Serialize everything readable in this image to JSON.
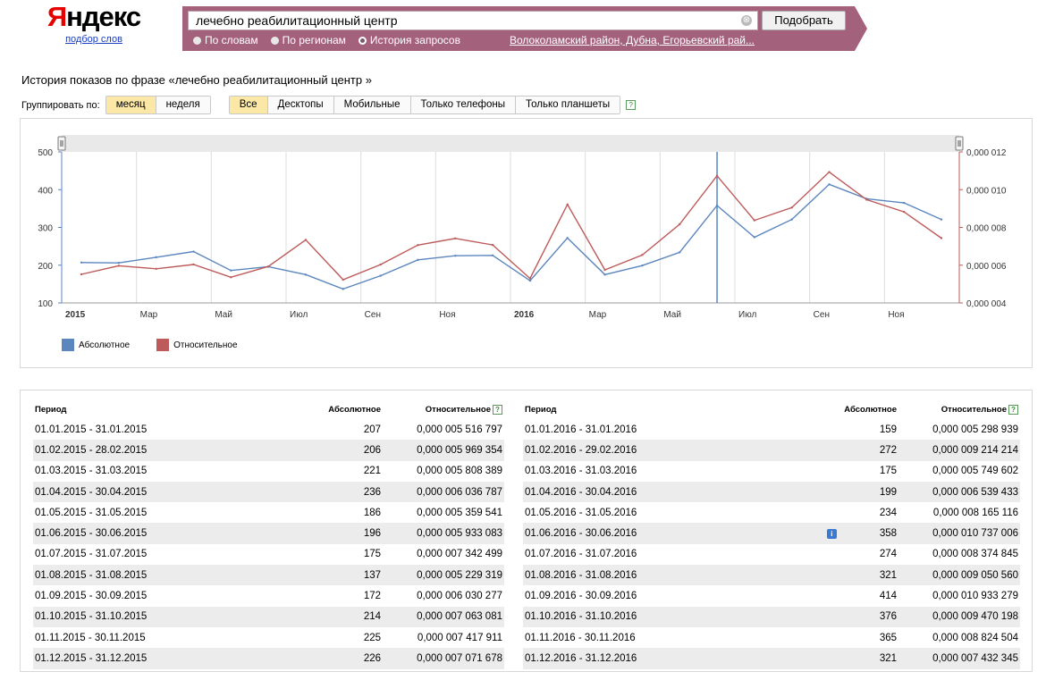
{
  "header": {
    "logo_text": "Яндекс",
    "logo_sub": "подбор слов",
    "search_value": "лечебно реабилитационный центр",
    "clear_glyph": "⊗",
    "search_button": "Подобрать",
    "radios": [
      {
        "label": "По словам",
        "selected": false
      },
      {
        "label": "По регионам",
        "selected": false
      },
      {
        "label": "История запросов",
        "selected": true
      }
    ],
    "region_link": "Волоколамский район, Дубна, Егорьевский рай..."
  },
  "page_title": "История показов по фразе «лечебно реабилитационный центр »",
  "grouping": {
    "label": "Группировать по:",
    "periods": [
      {
        "label": "месяц",
        "active": true
      },
      {
        "label": "неделя",
        "active": false
      }
    ],
    "devices": [
      {
        "label": "Все",
        "active": true
      },
      {
        "label": "Десктопы",
        "active": false
      },
      {
        "label": "Мобильные",
        "active": false
      },
      {
        "label": "Только телефоны",
        "active": false
      },
      {
        "label": "Только планшеты",
        "active": false
      }
    ],
    "help_glyph": "?"
  },
  "chart_data": {
    "type": "line",
    "x": [
      "2015-01",
      "2015-02",
      "2015-03",
      "2015-04",
      "2015-05",
      "2015-06",
      "2015-07",
      "2015-08",
      "2015-09",
      "2015-10",
      "2015-11",
      "2015-12",
      "2016-01",
      "2016-02",
      "2016-03",
      "2016-04",
      "2016-05",
      "2016-06",
      "2016-07",
      "2016-08",
      "2016-09",
      "2016-10",
      "2016-11",
      "2016-12"
    ],
    "x_tick_labels": [
      {
        "index": 0,
        "label": "2015",
        "bold": true
      },
      {
        "index": 2,
        "label": "Мар",
        "bold": false
      },
      {
        "index": 4,
        "label": "Май",
        "bold": false
      },
      {
        "index": 6,
        "label": "Июл",
        "bold": false
      },
      {
        "index": 8,
        "label": "Сен",
        "bold": false
      },
      {
        "index": 10,
        "label": "Ноя",
        "bold": false
      },
      {
        "index": 12,
        "label": "2016",
        "bold": true
      },
      {
        "index": 14,
        "label": "Мар",
        "bold": false
      },
      {
        "index": 16,
        "label": "Май",
        "bold": false
      },
      {
        "index": 18,
        "label": "Июл",
        "bold": false
      },
      {
        "index": 20,
        "label": "Сен",
        "bold": false
      },
      {
        "index": 22,
        "label": "Ноя",
        "bold": false
      }
    ],
    "y_left": {
      "min": 100,
      "max": 500,
      "ticks": [
        100,
        200,
        300,
        400,
        500
      ]
    },
    "y_right": {
      "min": 4e-06,
      "max": 1.2e-05,
      "ticks": [
        "0,000 004",
        "0,000 006",
        "0,000 008",
        "0,000 010",
        "0,000 012"
      ]
    },
    "series": [
      {
        "name": "Абсолютное",
        "color": "#5b86be",
        "axis": "left",
        "values": [
          207,
          206,
          221,
          236,
          186,
          196,
          175,
          137,
          172,
          214,
          225,
          226,
          159,
          272,
          175,
          199,
          234,
          358,
          274,
          321,
          414,
          376,
          365,
          321
        ]
      },
      {
        "name": "Относительное",
        "color": "#bd5a5a",
        "axis": "right",
        "values": [
          5.516797e-06,
          5.969354e-06,
          5.808389e-06,
          6.036787e-06,
          5.359541e-06,
          5.933083e-06,
          7.342499e-06,
          5.229319e-06,
          6.030277e-06,
          7.063081e-06,
          7.417911e-06,
          7.071678e-06,
          5.298939e-06,
          9.214214e-06,
          5.749602e-06,
          6.539433e-06,
          8.165116e-06,
          1.0737006e-05,
          8.374845e-06,
          9.05056e-06,
          1.0933279e-05,
          9.470198e-06,
          8.824504e-06,
          7.432345e-06
        ]
      }
    ],
    "marker_index": 17,
    "legend_position": "bottom-left",
    "grid": true
  },
  "table": {
    "headers": {
      "period": "Период",
      "absolute": "Абсолютное",
      "relative": "Относительное"
    },
    "info_glyph": "i",
    "left": [
      {
        "period": "01.01.2015 - 31.01.2015",
        "abs": "207",
        "rel": "0,000 005 516 797"
      },
      {
        "period": "01.02.2015 - 28.02.2015",
        "abs": "206",
        "rel": "0,000 005 969 354"
      },
      {
        "period": "01.03.2015 - 31.03.2015",
        "abs": "221",
        "rel": "0,000 005 808 389"
      },
      {
        "period": "01.04.2015 - 30.04.2015",
        "abs": "236",
        "rel": "0,000 006 036 787"
      },
      {
        "period": "01.05.2015 - 31.05.2015",
        "abs": "186",
        "rel": "0,000 005 359 541"
      },
      {
        "period": "01.06.2015 - 30.06.2015",
        "abs": "196",
        "rel": "0,000 005 933 083"
      },
      {
        "period": "01.07.2015 - 31.07.2015",
        "abs": "175",
        "rel": "0,000 007 342 499"
      },
      {
        "period": "01.08.2015 - 31.08.2015",
        "abs": "137",
        "rel": "0,000 005 229 319"
      },
      {
        "period": "01.09.2015 - 30.09.2015",
        "abs": "172",
        "rel": "0,000 006 030 277"
      },
      {
        "period": "01.10.2015 - 31.10.2015",
        "abs": "214",
        "rel": "0,000 007 063 081"
      },
      {
        "period": "01.11.2015 - 30.11.2015",
        "abs": "225",
        "rel": "0,000 007 417 911"
      },
      {
        "period": "01.12.2015 - 31.12.2015",
        "abs": "226",
        "rel": "0,000 007 071 678"
      }
    ],
    "right": [
      {
        "period": "01.01.2016 - 31.01.2016",
        "abs": "159",
        "rel": "0,000 005 298 939"
      },
      {
        "period": "01.02.2016 - 29.02.2016",
        "abs": "272",
        "rel": "0,000 009 214 214"
      },
      {
        "period": "01.03.2016 - 31.03.2016",
        "abs": "175",
        "rel": "0,000 005 749 602"
      },
      {
        "period": "01.04.2016 - 30.04.2016",
        "abs": "199",
        "rel": "0,000 006 539 433"
      },
      {
        "period": "01.05.2016 - 31.05.2016",
        "abs": "234",
        "rel": "0,000 008 165 116"
      },
      {
        "period": "01.06.2016 - 30.06.2016",
        "abs": "358",
        "rel": "0,000 010 737 006",
        "info": true
      },
      {
        "period": "01.07.2016 - 31.07.2016",
        "abs": "274",
        "rel": "0,000 008 374 845"
      },
      {
        "period": "01.08.2016 - 31.08.2016",
        "abs": "321",
        "rel": "0,000 009 050 560"
      },
      {
        "period": "01.09.2016 - 30.09.2016",
        "abs": "414",
        "rel": "0,000 010 933 279"
      },
      {
        "period": "01.10.2016 - 31.10.2016",
        "abs": "376",
        "rel": "0,000 009 470 198"
      },
      {
        "period": "01.11.2016 - 30.11.2016",
        "abs": "365",
        "rel": "0,000 008 824 504"
      },
      {
        "period": "01.12.2016 - 31.12.2016",
        "abs": "321",
        "rel": "0,000 007 432 345"
      }
    ]
  }
}
